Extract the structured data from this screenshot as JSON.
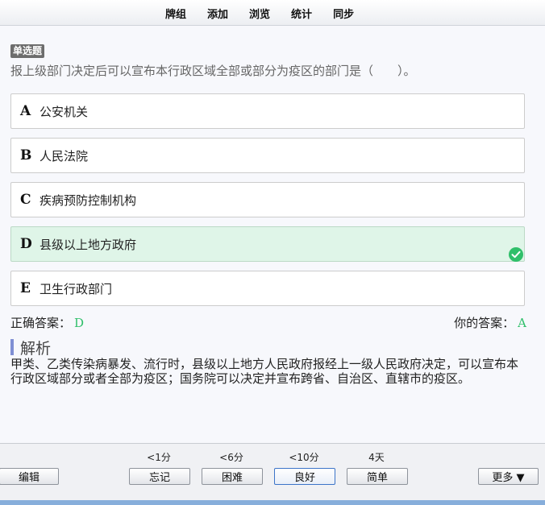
{
  "menu": [
    "牌组",
    "添加",
    "浏览",
    "统计",
    "同步"
  ],
  "question": {
    "type": "单选题",
    "text": "报上级部门决定后可以宣布本行政区域全部或部分为疫区的部门是（　　）。"
  },
  "options": [
    {
      "letter": "A",
      "text": "公安机关"
    },
    {
      "letter": "B",
      "text": "人民法院"
    },
    {
      "letter": "C",
      "text": "疾病预防控制机构"
    },
    {
      "letter": "D",
      "text": "县级以上地方政府"
    },
    {
      "letter": "E",
      "text": "卫生行政部门"
    }
  ],
  "answers": {
    "correct_label": "正确答案：",
    "correct_value": "D",
    "yours_label": "你的答案：",
    "yours_value": "A"
  },
  "analysis": {
    "title": "解析",
    "text": "甲类、乙类传染病暴发、流行时，县级以上地方人民政府报经上一级人民政府决定，可以宣布本行政区域部分或者全部为疫区；国务院可以决定并宣布跨省、自治区、直辖市的疫区。"
  },
  "bottom": {
    "edit": "编辑",
    "more": "更多 ▼",
    "buttons": [
      {
        "interval": "<1分",
        "label": "忘记"
      },
      {
        "interval": "<6分",
        "label": "困难"
      },
      {
        "interval": "<10分",
        "label": "良好"
      },
      {
        "interval": "4天",
        "label": "简单"
      }
    ]
  },
  "colors": {
    "correct_green": "#2fbf6a",
    "correct_bg": "#dff5e8",
    "accent": "#7f8fd4"
  }
}
